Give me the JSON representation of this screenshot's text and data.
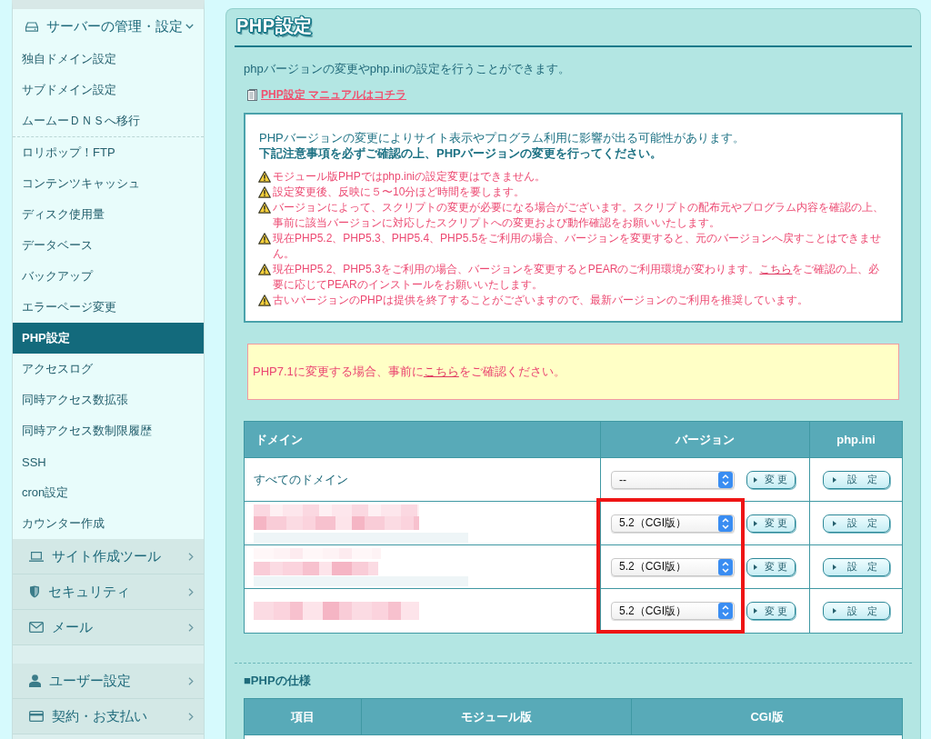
{
  "sidebar": {
    "menu_groups": [
      {
        "label": "サーバーの管理・設定",
        "expanded": true,
        "sections": [
          {
            "items": [
              {
                "label": "独自ドメイン設定",
                "selected": false
              },
              {
                "label": "サブドメイン設定",
                "selected": false
              },
              {
                "label": "ムームーＤＮＳへ移行",
                "selected": false
              }
            ]
          },
          {
            "items": [
              {
                "label": "ロリポップ！FTP",
                "selected": false
              },
              {
                "label": "コンテンツキャッシュ",
                "selected": false
              },
              {
                "label": "ディスク使用量",
                "selected": false
              },
              {
                "label": "データベース",
                "selected": false
              },
              {
                "label": "バックアップ",
                "selected": false
              },
              {
                "label": "エラーページ変更",
                "selected": false
              },
              {
                "label": "PHP設定",
                "selected": true
              },
              {
                "label": "アクセスログ",
                "selected": false
              },
              {
                "label": "同時アクセス数拡張",
                "selected": false
              },
              {
                "label": "同時アクセス数制限履歴",
                "selected": false
              },
              {
                "label": "SSH",
                "selected": false
              },
              {
                "label": "cron設定",
                "selected": false
              },
              {
                "label": "カウンター作成",
                "selected": false
              }
            ]
          }
        ]
      },
      {
        "label": "サイト作成ツール",
        "expanded": false
      },
      {
        "label": "セキュリティ",
        "expanded": false
      },
      {
        "label": "メール",
        "expanded": false
      }
    ],
    "account_groups": [
      {
        "label": "ユーザー設定",
        "expanded": false
      },
      {
        "label": "契約・お支払い",
        "expanded": false
      }
    ]
  },
  "page": {
    "title": "PHP設定",
    "intro": "phpバージョンの変更やphp.iniの設定を行うことができます。",
    "manual_link": "PHP設定 マニュアルはコチラ",
    "notice": {
      "lead": "PHPバージョンの変更によりサイト表示やプログラム利用に影響が出る可能性があります。",
      "emphasis": "下記注意事項を必ずご確認の上、PHPバージョンの変更を行ってください。",
      "warnings": [
        {
          "parts": [
            {
              "kind": "text",
              "text": "モジュール版PHPではphp.iniの設定変更はできません。"
            }
          ]
        },
        {
          "parts": [
            {
              "kind": "text",
              "text": "設定変更後、反映に５〜10分ほど時間を要します。"
            }
          ]
        },
        {
          "parts": [
            {
              "kind": "text",
              "text": "バージョンによって、スクリプトの変更が必要になる場合がございます。スクリプトの配布元やプログラム内容を確認の上、事前に該当バージョンに対応したスクリプトへの変更および動作確認をお願いいたします。"
            }
          ]
        },
        {
          "parts": [
            {
              "kind": "text",
              "text": "現在PHP5.2、PHP5.3、PHP5.4、PHP5.5をご利用の場合、バージョンを変更すると、元のバージョンへ戻すことはできません。"
            }
          ]
        },
        {
          "parts": [
            {
              "kind": "text",
              "text": "現在PHP5.2、PHP5.3をご利用の場合、バージョンを変更するとPEARのご利用環境が変わります。"
            },
            {
              "kind": "link",
              "text": "こちら"
            },
            {
              "kind": "text",
              "text": "をご確認の上、必要に応じてPEARのインストールをお願いいたします。"
            }
          ]
        },
        {
          "parts": [
            {
              "kind": "text",
              "text": "古いバージョンのPHPは提供を終了することがございますので、最新バージョンのご利用を推奨しています。"
            }
          ]
        }
      ]
    },
    "alert": {
      "parts": [
        {
          "kind": "text",
          "text": "PHP7.1に変更する場合、事前に"
        },
        {
          "kind": "link",
          "text": "こちら"
        },
        {
          "kind": "text",
          "text": "をご確認ください。"
        }
      ]
    },
    "domain_table": {
      "columns": [
        "ドメイン",
        "バージョン",
        "php.ini"
      ],
      "rows": [
        {
          "kind": "named",
          "domain": "すべてのドメイン",
          "version": "--",
          "change_button": "変 更",
          "settings_button": "設　定",
          "highlighted": false
        },
        {
          "kind": "redacted",
          "version": "5.2（CGI版）",
          "change_button": "変 更",
          "settings_button": "設　定",
          "highlighted": true
        },
        {
          "kind": "redacted",
          "version": "5.2（CGI版）",
          "change_button": "変 更",
          "settings_button": "設　定",
          "highlighted": true
        },
        {
          "kind": "redacted",
          "version": "5.2（CGI版）",
          "change_button": "変 更",
          "settings_button": "設　定",
          "highlighted": true
        }
      ]
    },
    "spec_section": {
      "heading": "■PHPの仕様",
      "columns": [
        "項目",
        "モジュール版",
        "CGI版"
      ]
    }
  }
}
